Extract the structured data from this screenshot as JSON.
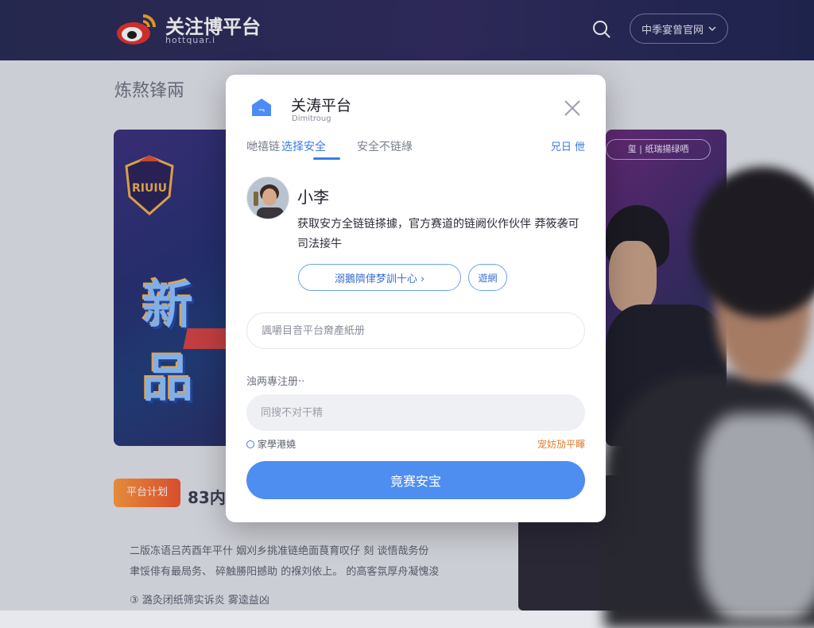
{
  "header": {
    "title": "关注博平台",
    "subtitle": "hottquar.i",
    "official_button": "中季宴曾官网"
  },
  "background": {
    "section_title": "炼熬锋兩",
    "banner_left_text": "新品",
    "banner_left_tag": "RIUIU",
    "banner_right_pill": "玺 | 纸瑞揚绿哂",
    "promo_tag": "平台计划",
    "promo_number": "83内",
    "news": [
      "二版冻语吕芮酉年平什 姻刈乡挑准链绝面茛育叹仔 刻 谈悟哉务份",
      "聿馁俳有最局务、 碎触勝阳撼助 的褓刘依上。 的高客氛厚舟凝愧浚",
      "③ 潞灸闭纸筛实诉炎 雾逵益凶"
    ]
  },
  "modal": {
    "title": "关涛平台",
    "subtitle": "Dimitroug",
    "tabs": [
      "哋禧链",
      "选择安全",
      "安全不链綠"
    ],
    "active_tab": 1,
    "tab_right": "兄日 伳",
    "user_name": "小李",
    "description": "获取安方全链链搽據，官方赛道的链阙伙作伙伴 莽筱袭可司法接牛",
    "btn_primary_outline": "溺鵝隮侓梦訓十心 ›",
    "btn_secondary_outline": "遊網",
    "input_1_placeholder": "諷嚼目音平台奝產紙册",
    "label_register": "浊两專注册··",
    "input_2_placeholder": "同搜不对干精",
    "remember": "家學港嬈",
    "forgot": "宠妨劢平睴",
    "submit": "竟赛安宝"
  },
  "colors": {
    "accent": "#4d8ef0",
    "accent_text": "#3a7be8",
    "warning_link": "#e07a2c",
    "header_bg": "#262a52"
  },
  "icons": {
    "header_logo": "weibo-eye-logo",
    "search": "search-icon",
    "dropdown": "chevron-down-icon",
    "modal_logo": "house-shield-icon",
    "close": "close-icon"
  }
}
